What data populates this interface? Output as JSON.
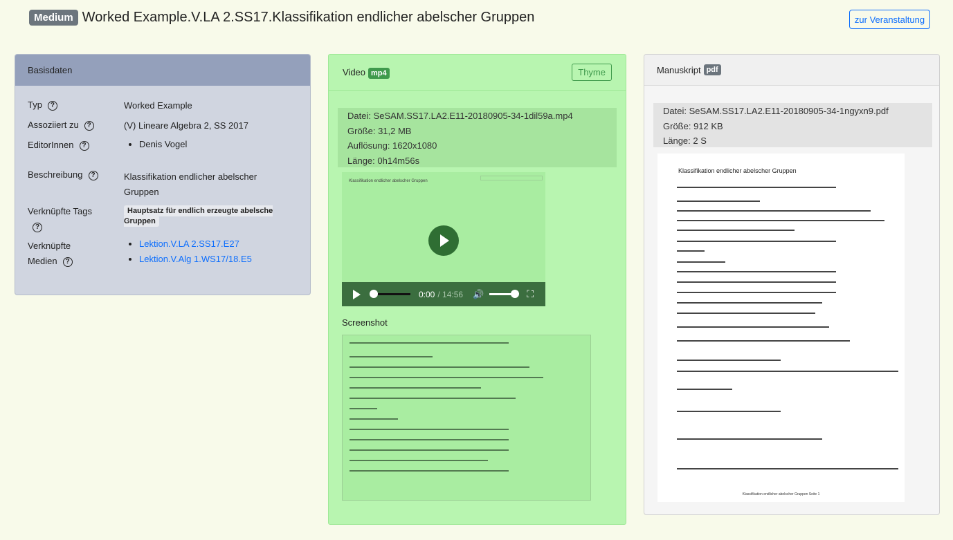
{
  "header": {
    "level_badge": "Medium",
    "title": "Worked Example.V.LA 2.SS17.Klassifikation endlicher abelscher Gruppen",
    "course_button": "zur Veranstaltung"
  },
  "basis": {
    "title": "Basisdaten",
    "rows": {
      "typ_label": "Typ",
      "typ_value": "Worked Example",
      "assoc_label": "Assoziiert zu",
      "assoc_value": "(V) Lineare Algebra 2, SS 2017",
      "editors_label": "EditorInnen",
      "editors": [
        "Denis Vogel"
      ],
      "desc_label": "Beschreibung",
      "desc_value": "Klassifikation endlicher abelscher Gruppen",
      "tags_label": "Verknüpfte Tags",
      "tags": [
        "Hauptsatz für endlich erzeugte abelsche Gruppen"
      ],
      "media_label_1": "Verknüpfte",
      "media_label_2": "Medien",
      "media": [
        "Lektion.V.LA 2.SS17.E27",
        "Lektion.V.Alg 1.WS17/18.E5"
      ]
    },
    "help_glyph": "?"
  },
  "video": {
    "title": "Video",
    "format": "mp4",
    "thyme_button": "Thyme",
    "file_lines": [
      "Datei: SeSAM.SS17.LA2.E11-20180905-34-1dil59a.mp4",
      "Größe: 31,2 MB",
      "Auflösung: 1620x1080",
      "Länge: 0h14m56s"
    ],
    "thumb_title": "Klassifikation endlicher abelscher Gruppen",
    "time_current": "0:00",
    "time_duration": "/ 14:56",
    "progress": 0,
    "volume": 1,
    "screenshot_label": "Screenshot"
  },
  "manuskript": {
    "title": "Manuskript",
    "format": "pdf",
    "file_lines": [
      "Datei: SeSAM.SS17.LA2.E11-20180905-34-1ngyxn9.pdf",
      "Größe: 912 KB",
      "Länge: 2 S"
    ],
    "page_title": "Klassifikation endlicher abelscher Gruppen",
    "page_footer": "Klassifikation endlicher abelscher Gruppen Seite 1"
  },
  "colors": {
    "page_bg": "#f8faea",
    "video_bg": "#b8f5b0",
    "basis_header": "#94a0bb",
    "link": "#0d6efd"
  }
}
